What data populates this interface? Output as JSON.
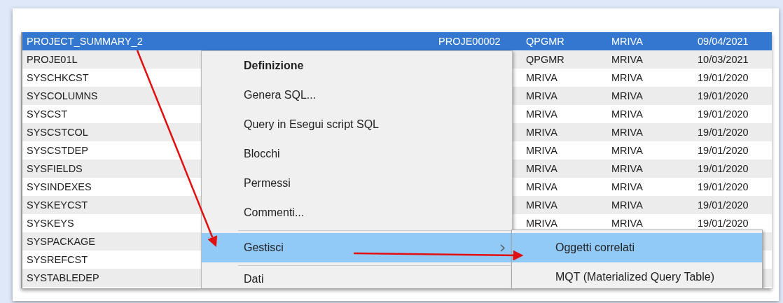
{
  "table": {
    "rows": [
      {
        "name": "PROJECT_SUMMARY_2",
        "column_2": "PROJE00002",
        "column_3": "QPGMR",
        "column_4": "MRIVA",
        "column_5": "09/04/2021",
        "selected": true
      },
      {
        "name": "PROJE01L",
        "column_3": "QPGMR",
        "column_4": "MRIVA",
        "column_5": "10/03/2021",
        "selected": false
      },
      {
        "name": "SYSCHKCST",
        "column_3": "MRIVA",
        "column_4": "MRIVA",
        "column_5": "19/01/2020",
        "selected": false
      },
      {
        "name": "SYSCOLUMNS",
        "column_3": "MRIVA",
        "column_4": "MRIVA",
        "column_5": "19/01/2020",
        "selected": false
      },
      {
        "name": "SYSCST",
        "column_3": "MRIVA",
        "column_4": "MRIVA",
        "column_5": "19/01/2020",
        "selected": false
      },
      {
        "name": "SYSCSTCOL",
        "column_3": "MRIVA",
        "column_4": "MRIVA",
        "column_5": "19/01/2020",
        "selected": false
      },
      {
        "name": "SYSCSTDEP",
        "column_3": "MRIVA",
        "column_4": "MRIVA",
        "column_5": "19/01/2020",
        "selected": false
      },
      {
        "name": "SYSFIELDS",
        "column_3": "MRIVA",
        "column_4": "MRIVA",
        "column_5": "19/01/2020",
        "selected": false
      },
      {
        "name": "SYSINDEXES",
        "column_3": "MRIVA",
        "column_4": "MRIVA",
        "column_5": "19/01/2020",
        "selected": false
      },
      {
        "name": "SYSKEYCST",
        "column_3": "MRIVA",
        "column_4": "MRIVA",
        "column_5": "19/01/2020",
        "selected": false
      },
      {
        "name": "SYSKEYS",
        "column_3": "MRIVA",
        "column_4": "MRIVA",
        "column_5": "19/01/2020",
        "selected": false
      },
      {
        "name": "SYSPACKAGE",
        "selected": false
      },
      {
        "name": "SYSREFCST",
        "selected": false
      },
      {
        "name": "SYSTABLEDEP",
        "selected": false
      }
    ]
  },
  "context_menu": {
    "items": [
      {
        "kind": "item",
        "label": "Definizione",
        "bold": true
      },
      {
        "kind": "item",
        "label": "Genera SQL...",
        "bold": false
      },
      {
        "kind": "item",
        "label": "Query in Esegui script SQL",
        "bold": false
      },
      {
        "kind": "item",
        "label": "Blocchi",
        "bold": false
      },
      {
        "kind": "item",
        "label": "Permessi",
        "bold": false
      },
      {
        "kind": "item",
        "label": "Commenti...",
        "bold": false
      },
      {
        "kind": "separator"
      },
      {
        "kind": "submenu",
        "label": "Gestisci",
        "selected": true
      },
      {
        "kind": "separator"
      },
      {
        "kind": "item",
        "label": "Dati",
        "bold": false
      }
    ]
  },
  "submenu": {
    "items": [
      {
        "label": "Oggetti correlati",
        "selected": true
      },
      {
        "label": "MQT (Materialized Query Table)",
        "selected": false
      }
    ]
  }
}
